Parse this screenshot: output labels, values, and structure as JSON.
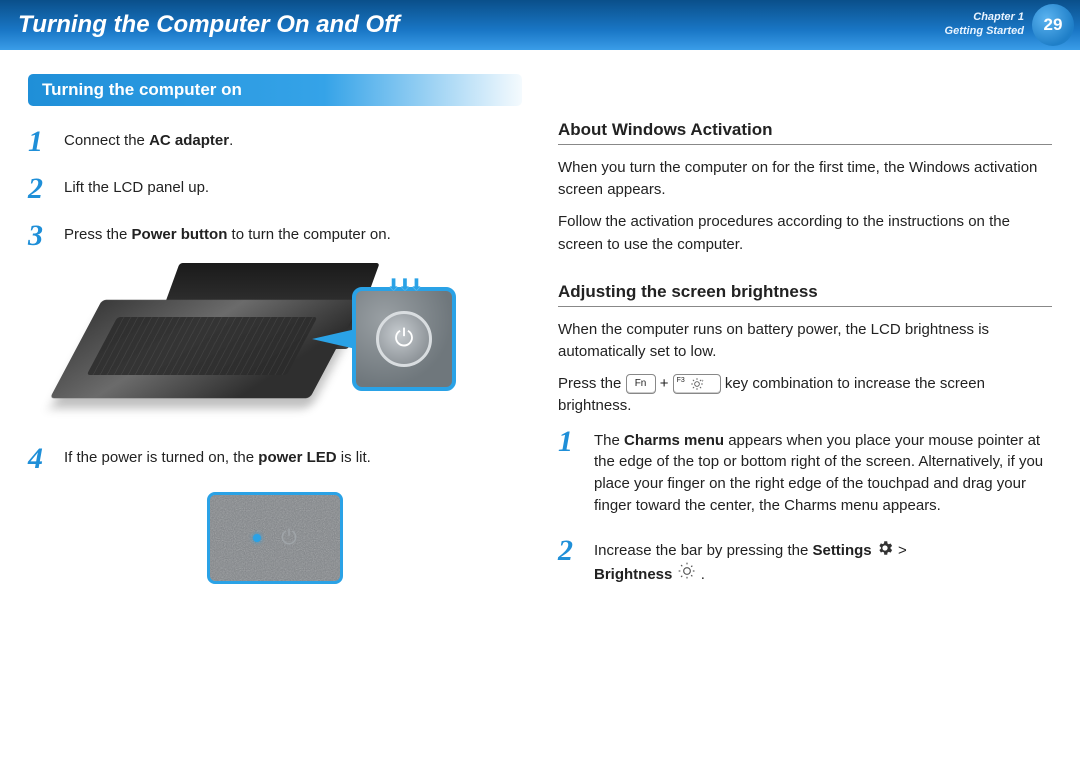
{
  "header": {
    "title": "Turning the Computer On and Off",
    "chapter_line1": "Chapter 1",
    "chapter_line2": "Getting Started",
    "page_number": "29"
  },
  "left": {
    "section_title": "Turning the computer on",
    "steps": {
      "s1_pre": "Connect the ",
      "s1_bold": "AC adapter",
      "s1_post": ".",
      "s2": "Lift the LCD panel up.",
      "s3_pre": "Press the ",
      "s3_bold": "Power button",
      "s3_post": " to turn the computer on.",
      "s4_pre": "If the power is turned on, the ",
      "s4_bold": "power LED",
      "s4_post": " is lit."
    },
    "nums": {
      "n1": "1",
      "n2": "2",
      "n3": "3",
      "n4": "4"
    }
  },
  "right": {
    "h1": "About Windows Activation",
    "p1": "When you turn the computer on for the first time, the Windows activation screen appears.",
    "p2": "Follow the activation procedures according to the instructions on the screen to use the computer.",
    "h2": "Adjusting the screen brightness",
    "p3": "When the computer runs on battery power, the LCD brightness is automatically set to low.",
    "p4_pre": "Press the ",
    "key_fn": "Fn",
    "plus": " + ",
    "key_f3_label": "F3",
    "p4_post": " key combination to increase the screen brightness.",
    "steps": {
      "n1": "1",
      "s1_pre": "The ",
      "s1_bold": "Charms menu",
      "s1_post": " appears when you place your mouse pointer at the edge of the top or bottom right of the screen. Alternatively, if you place your finger on the right edge of the touchpad and drag your finger toward the center, the Charms menu appears.",
      "n2": "2",
      "s2_pre": "Increase the bar by pressing the ",
      "s2_bold1": "Settings",
      "s2_gt": " > ",
      "s2_bold2": "Brightness",
      "s2_post": " ."
    }
  }
}
